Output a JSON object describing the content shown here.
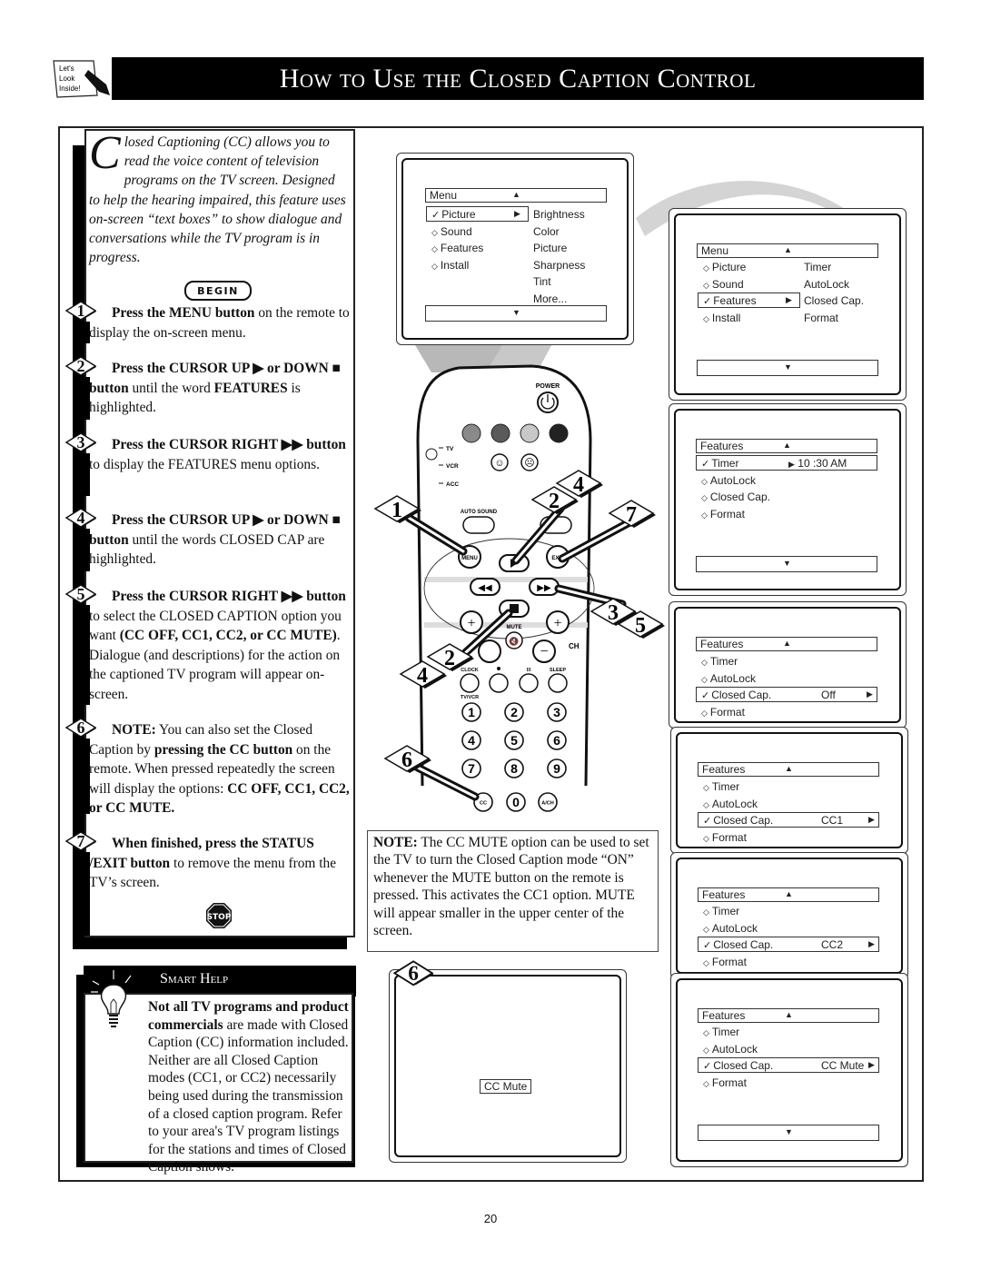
{
  "header": {
    "logo_lines": [
      "Let's",
      "Look",
      "Inside!"
    ],
    "title": "How to Use the Closed Caption Control"
  },
  "intro": {
    "drop_cap": "C",
    "text": "losed Captioning (CC) allows you to read the voice content of television programs on the TV screen. Designed to help the hearing impaired, this feature uses on-screen “text boxes” to show dialogue and conversations while the TV program is in progress."
  },
  "begin_label": "BEGIN",
  "steps": [
    {
      "num": "1",
      "bold": "Press the MENU button",
      "rest": " on the remote to display the on-screen menu."
    },
    {
      "num": "2",
      "bold": "Press the CURSOR UP ▶ or DOWN ■ button",
      "rest": " until the word ",
      "bold2": "FEATURES",
      "rest2": " is highlighted."
    },
    {
      "num": "3",
      "bold": "Press the CURSOR RIGHT ▶▶ button",
      "rest": " to display the FEATURES menu options."
    },
    {
      "num": "4",
      "bold": "Press the CURSOR UP ▶ or DOWN ■ button",
      "rest": " until the words CLOSED CAP are highlighted."
    },
    {
      "num": "5",
      "bold": "Press the CURSOR RIGHT ▶▶ button",
      "rest": " to select the CLOSED CAPTION option you want ",
      "bold2": "(CC OFF, CC1, CC2, or CC MUTE)",
      "rest2": ". Dialogue (and descriptions) for the action on the captioned TV program will appear on-screen."
    },
    {
      "num": "6",
      "bold": "NOTE:",
      "rest": " You can also set the Closed Caption by ",
      "bold2": "pressing the CC button",
      "rest2": " on the remote. When pressed repeatedly the screen will display the options: ",
      "bold3": "CC OFF, CC1, CC2, or CC MUTE."
    },
    {
      "num": "7",
      "bold": "When finished, press the STATUS /EXIT button",
      "rest": " to remove the menu from the TV’s screen."
    }
  ],
  "stop_label": "STOP",
  "smart_help": {
    "title": "Smart Help",
    "bold": "Not all TV programs and product commercials",
    "text": " are made with Closed Caption (CC) information included. Neither are all Closed Caption modes (CC1, or CC2) necessarily being used during the transmission of a closed caption program. Refer to your area's TV program listings for the stations and times of Closed Caption shows."
  },
  "note": {
    "bold": "NOTE:",
    "text": " The CC MUTE option can be used to set the TV to turn the Closed Caption mode “ON” whenever the MUTE button on the remote is pressed. This activates the CC1 option. MUTE will appear smaller in the upper center of the screen."
  },
  "screens": {
    "main_menu": {
      "title": "Menu",
      "items": [
        "Picture",
        "Sound",
        "Features",
        "Install"
      ],
      "selected": "Picture",
      "submenu": [
        "Brightness",
        "Color",
        "Picture",
        "Sharpness",
        "Tint",
        "More..."
      ]
    },
    "features_selected": {
      "title": "Menu",
      "items": [
        "Picture",
        "Sound",
        "Features",
        "Install"
      ],
      "selected": "Features",
      "submenu": [
        "Timer",
        "AutoLock",
        "Closed Cap.",
        "Format"
      ]
    },
    "features_menu": {
      "title": "Features",
      "items": [
        "Timer",
        "AutoLock",
        "Closed Cap.",
        "Format"
      ],
      "selected": "Timer",
      "selected_value": "10 :30 AM"
    },
    "cc_off": {
      "title": "Features",
      "items": [
        "Timer",
        "AutoLock",
        "Closed Cap.",
        "Format"
      ],
      "selected": "Closed Cap.",
      "selected_value": "Off"
    },
    "cc1": {
      "title": "Features",
      "items": [
        "Timer",
        "AutoLock",
        "Closed Cap.",
        "Format"
      ],
      "selected": "Closed Cap.",
      "selected_value": "CC1"
    },
    "cc2": {
      "title": "Features",
      "items": [
        "Timer",
        "AutoLock",
        "Closed Cap.",
        "Format"
      ],
      "selected": "Closed Cap.",
      "selected_value": "CC2"
    },
    "cc_mute": {
      "title": "Features",
      "items": [
        "Timer",
        "AutoLock",
        "Closed Cap.",
        "Format"
      ],
      "selected": "Closed Cap.",
      "selected_value": "CC Mute"
    },
    "mute_screen": {
      "label": "CC Mute",
      "badge": "6"
    }
  },
  "remote": {
    "power_label": "POWER",
    "mode_labels": [
      "TV",
      "VCR",
      "ACC"
    ],
    "auto_sound_label": "AUTO SOUND",
    "menu_label": "MENU",
    "exit_label": "EXIT",
    "mute_label": "MUTE",
    "ch_label": "CH",
    "clock_label": "CLOCK",
    "sleep_label": "SLEEP",
    "tvvcr_label": "TV/VCR",
    "keys": [
      "1",
      "2",
      "3",
      "4",
      "5",
      "6",
      "7",
      "8",
      "9",
      "CC",
      "0",
      "A/CH"
    ],
    "callouts": [
      "1",
      "2",
      "4",
      "7",
      "3",
      "5",
      "4",
      "2",
      "6"
    ]
  },
  "page_number": "20"
}
